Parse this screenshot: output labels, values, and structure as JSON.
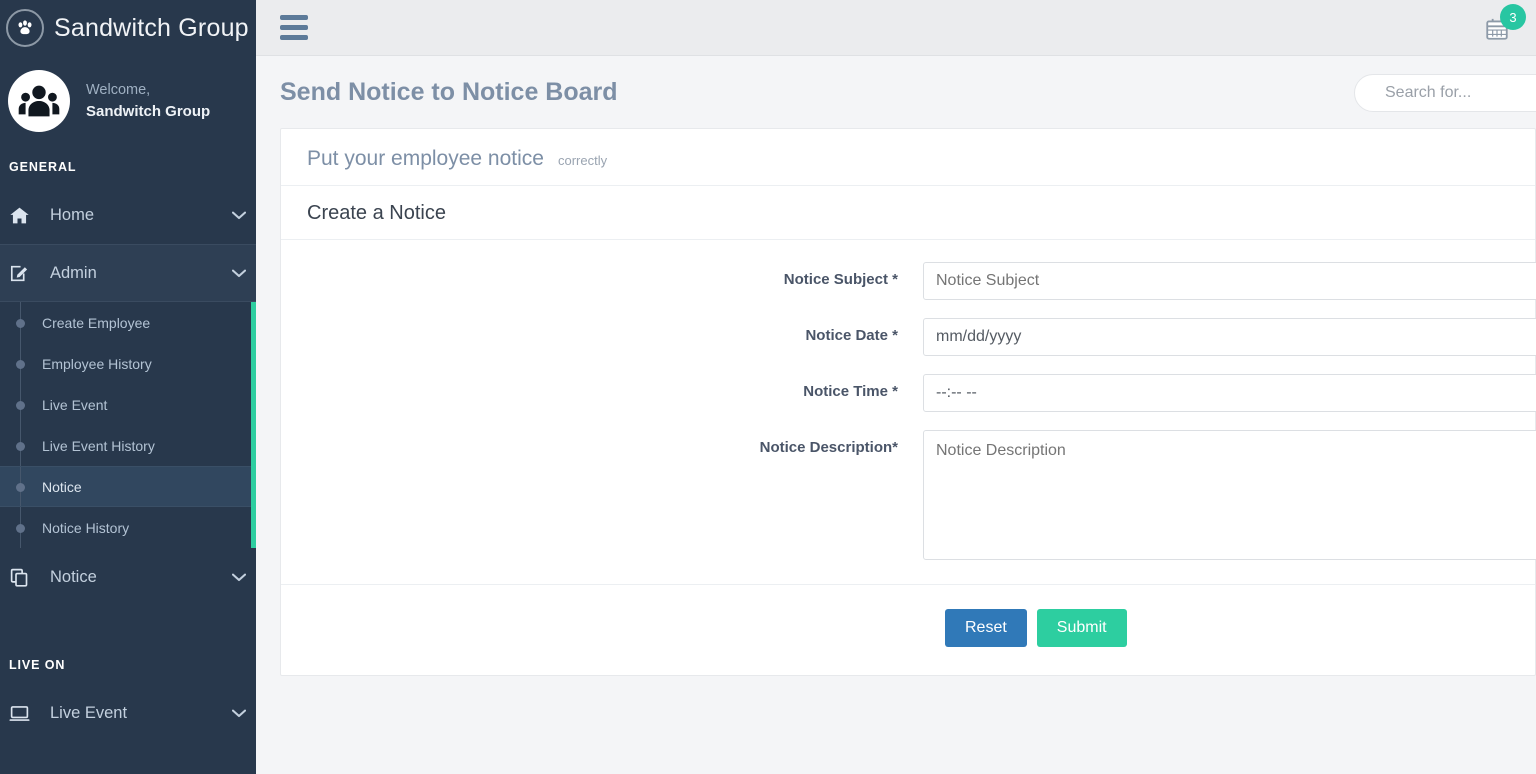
{
  "brand": {
    "name": "Sandwitch Group",
    "logo_icon": "paw-icon"
  },
  "profile": {
    "welcome_label": "Welcome,",
    "user_name": "Sandwitch Group",
    "avatar_icon": "group-people-icon"
  },
  "sidebar": {
    "sections": [
      {
        "heading": "GENERAL",
        "items": [
          {
            "label": "Home",
            "icon": "home-icon",
            "caret": "chevron-down-icon",
            "expanded": false
          },
          {
            "label": "Admin",
            "icon": "edit-square-icon",
            "caret": "chevron-down-icon",
            "expanded": true,
            "children": [
              {
                "label": "Create Employee",
                "active": false
              },
              {
                "label": "Employee History",
                "active": false
              },
              {
                "label": "Live Event",
                "active": false
              },
              {
                "label": "Live Event History",
                "active": false
              },
              {
                "label": "Notice",
                "active": true
              },
              {
                "label": "Notice History",
                "active": false
              }
            ]
          },
          {
            "label": "Notice",
            "icon": "copy-icon",
            "caret": "chevron-down-icon",
            "expanded": false
          }
        ]
      },
      {
        "heading": "LIVE ON",
        "items": [
          {
            "label": "Live Event",
            "icon": "desktop-icon",
            "caret": "chevron-down-icon",
            "expanded": false
          }
        ]
      }
    ]
  },
  "topbar": {
    "menu_toggle_icon": "hamburger-icon",
    "calendar_icon": "calendar-icon",
    "calendar_badge": "3"
  },
  "page": {
    "title": "Send Notice to Notice Board",
    "search_placeholder": "Search for..."
  },
  "card": {
    "header_title": "Put your employee notice",
    "header_subtitle": "correctly",
    "section_title": "Create a Notice",
    "fields": [
      {
        "label": "Notice Subject",
        "required_mark": " *",
        "placeholder": "Notice Subject",
        "value": "",
        "type": "text"
      },
      {
        "label": "Notice Date",
        "required_mark": " *",
        "placeholder": "mm/dd/yyyy",
        "value": "mm/dd/yyyy",
        "type": "date"
      },
      {
        "label": "Notice Time",
        "required_mark": " *",
        "placeholder": "--:-- --",
        "value": "--:-- --",
        "type": "time"
      },
      {
        "label": "Notice Description",
        "required_mark": "*",
        "placeholder": "Notice Description",
        "value": "",
        "type": "textarea"
      }
    ],
    "buttons": {
      "reset_label": "Reset",
      "submit_label": "Submit"
    }
  },
  "colors": {
    "sidebar_bg": "#28384c",
    "accent_teal": "#2dcea0",
    "reset_blue": "#3079b8",
    "title_slate": "#7d8fa6"
  }
}
